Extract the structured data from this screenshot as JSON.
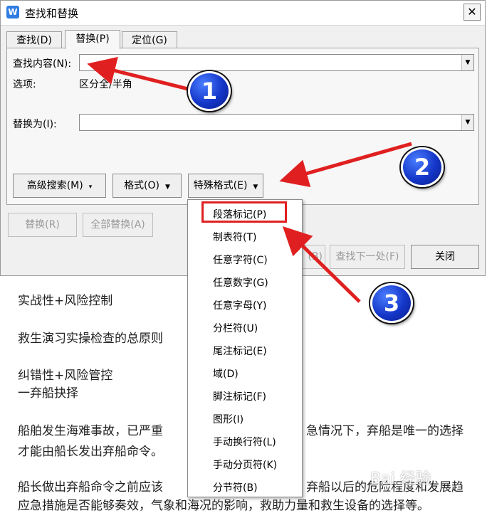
{
  "dialog": {
    "title": "查找和替换",
    "app_icon": "W",
    "close_glyph": "✕",
    "tabs": [
      {
        "label": "查找(D)"
      },
      {
        "label": "替换(P)"
      },
      {
        "label": "定位(G)"
      }
    ],
    "find_label": "查找内容(N):",
    "find_value": "",
    "options_label": "选项:",
    "options_value": "区分全/半角",
    "replace_label": "替换为(I):",
    "replace_value": "",
    "buttons": {
      "advanced": "高级搜索(M)",
      "format": "格式(O)",
      "special": "特殊格式(E)",
      "replace": "替换(R)",
      "replace_all": "全部替换(A)",
      "find_prev_tail": "(B)",
      "find_next": "查找下一处(F)",
      "close": "关闭"
    }
  },
  "special_menu": {
    "items": [
      "段落标记(P)",
      "制表符(T)",
      "任意字符(C)",
      "任意数字(G)",
      "任意字母(Y)",
      "分栏符(U)",
      "尾注标记(E)",
      "域(D)",
      "脚注标记(F)",
      "图形(I)",
      "手动换行符(L)",
      "手动分页符(K)",
      "分节符(B)"
    ]
  },
  "document": {
    "lines": [
      "实战性+风险控制",
      "救生演习实操检查的总原则",
      "纠错性+风险管控",
      "一弃船抉择",
      "船舶发生海难事故，已严重",
      "急情况下，弃船是唯一的选择",
      "才能由船长发出弃船命令。",
      "船长做出弃船命令之前应该",
      "弃船以后的危险程度和发展趋",
      "应急措施是否能够奏效，气象和海况的影响，救助力量和救生设备的选择等。"
    ]
  },
  "annotations": {
    "badges": [
      "1",
      "2",
      "3"
    ],
    "arrow_color": "#e02020",
    "badge_color": "#1436c8"
  },
  "watermark": "Bai 经验"
}
